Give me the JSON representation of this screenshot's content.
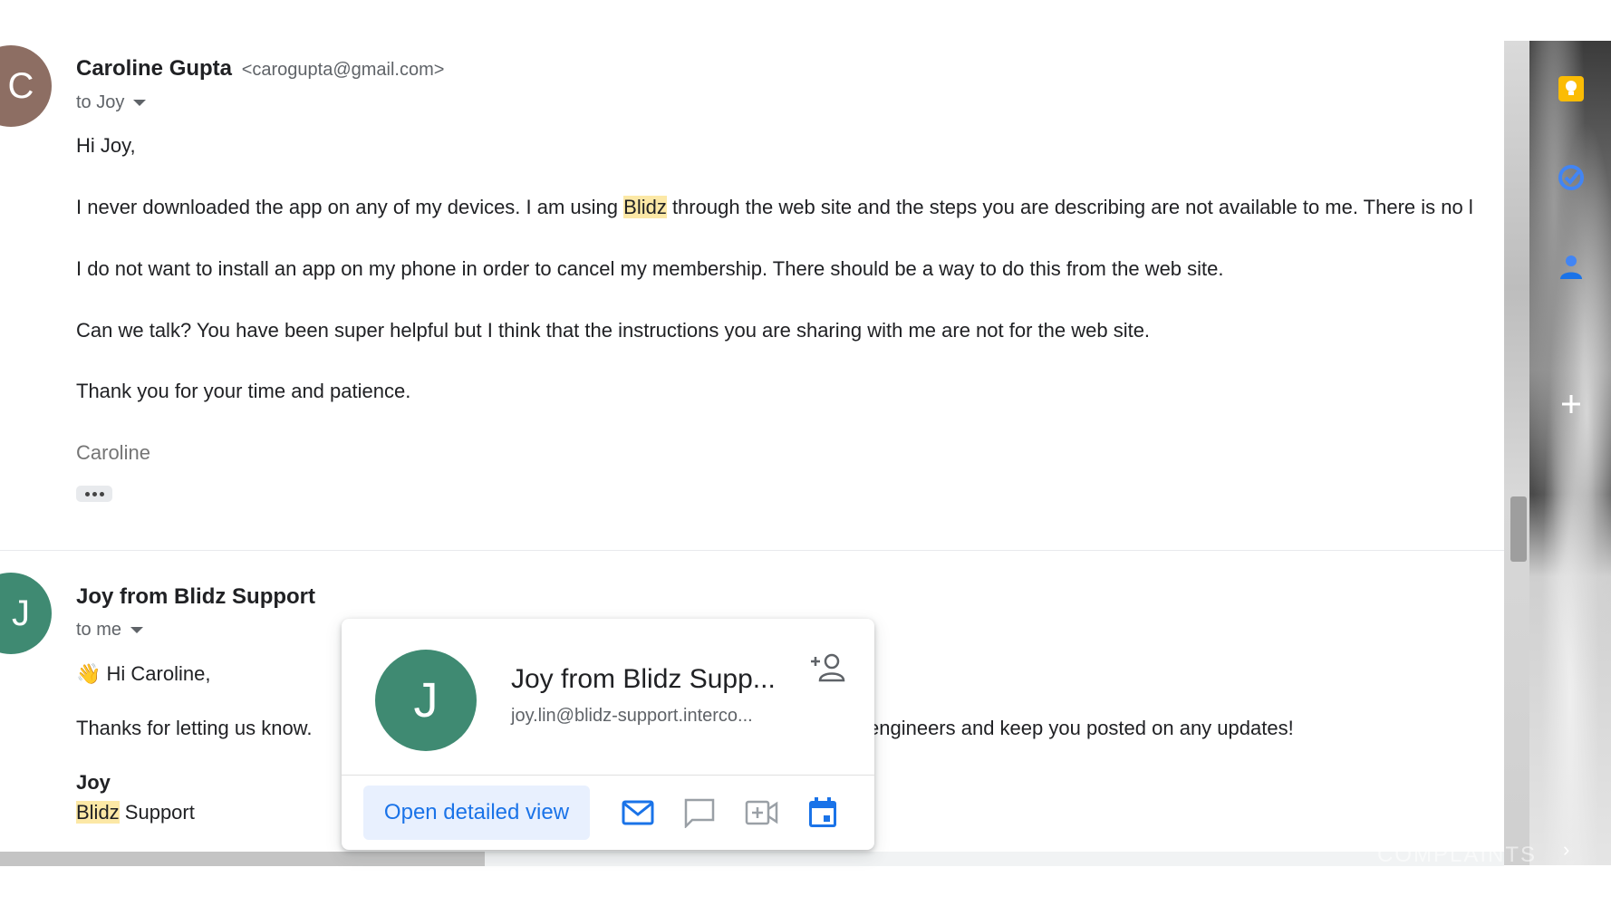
{
  "message1": {
    "avatar_letter": "C",
    "sender_name": "Caroline Gupta",
    "sender_email": "<carogupta@gmail.com>",
    "to_label": "to Joy",
    "greeting": "Hi Joy,",
    "p1_before": "I never downloaded the app on any of my devices. I am using ",
    "p1_highlight": "Blidz",
    "p1_after": " through the web site and the steps you are describing are not available to me. There is no l",
    "p2": "I do not want to install an app on my phone in order to cancel my membership. There should be a way to do this from the web site.",
    "p3": "Can we talk? You have been super helpful but I think that the instructions you are sharing with me are not for the web site.",
    "p4": "Thank you for your time and patience.",
    "signature": "Caroline"
  },
  "message2": {
    "avatar_letter": "J",
    "sender_name": "Joy from Blidz Support",
    "to_label": "to me",
    "greeting_emoji": "👋",
    "greeting": "Hi Caroline,",
    "p1_left": "Thanks for letting us know.",
    "p1_right": "engineers and keep you posted on any updates!",
    "sig_name": "Joy",
    "sig_company_highlight": "Blidz",
    "sig_company_rest": " Support"
  },
  "hover_card": {
    "avatar_letter": "J",
    "name": "Joy from Blidz Supp...",
    "email": "joy.lin@blidz-support.interco...",
    "open_button_label": "Open detailed view",
    "icons": [
      "add-contact-icon",
      "mail-icon",
      "chat-icon",
      "video-call-icon",
      "calendar-icon"
    ]
  },
  "side_panel": {
    "icons": [
      "keep-icon",
      "tasks-icon",
      "contacts-icon",
      "add-icon"
    ],
    "watermark": "COMPLAINTS"
  },
  "colors": {
    "highlight": "#fce8a6",
    "accent_blue": "#1a73e8",
    "avatar_c": "#8d6e63",
    "avatar_j": "#3f8a72"
  }
}
